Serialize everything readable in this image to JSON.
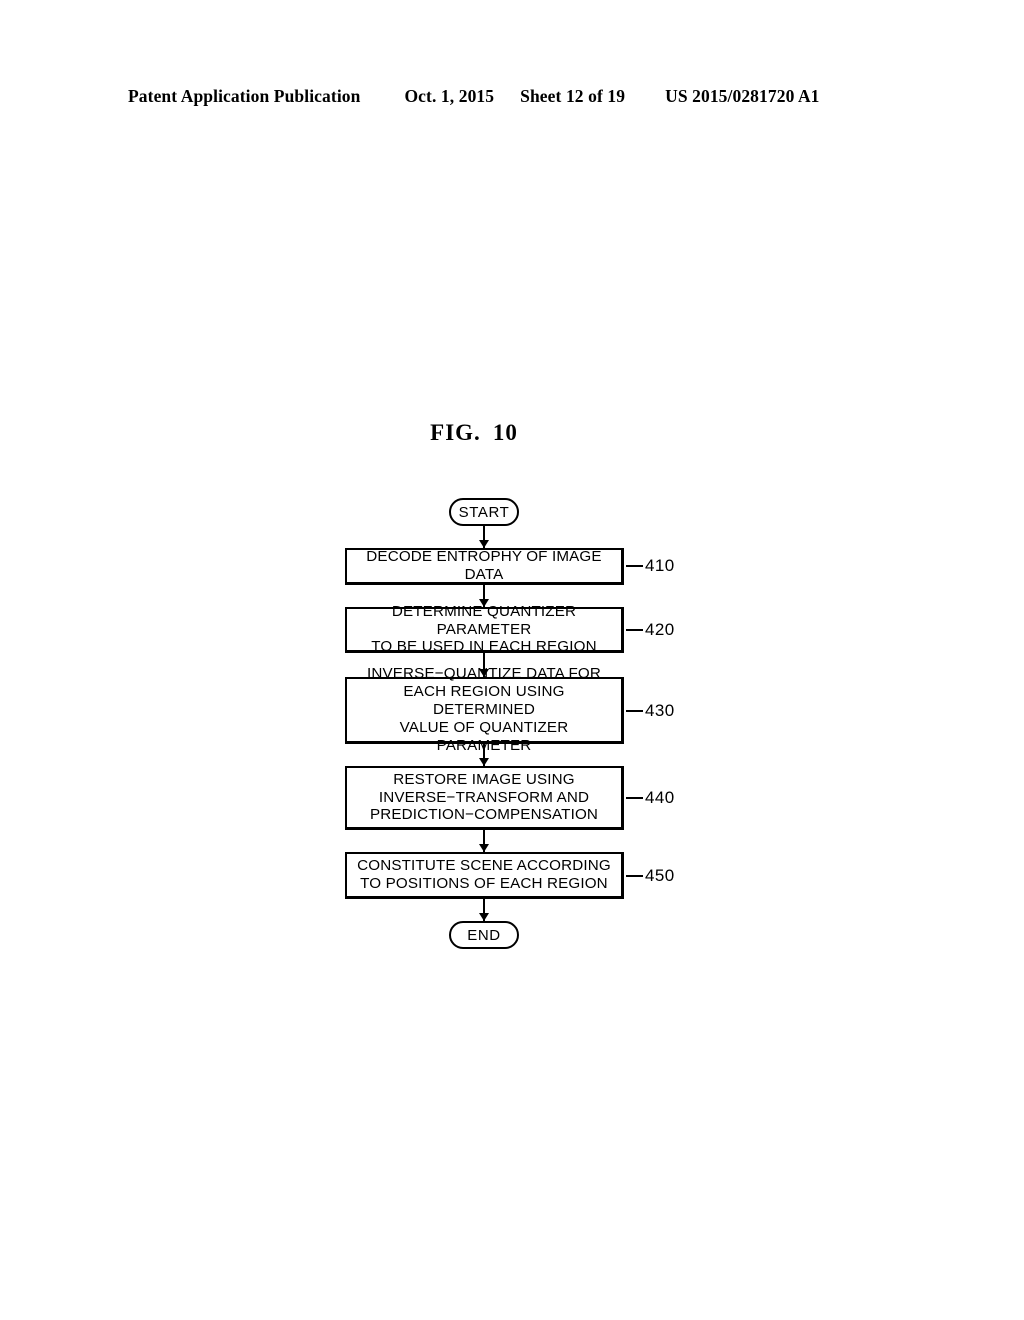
{
  "header": {
    "publication": "Patent Application Publication",
    "date": "Oct. 1, 2015",
    "sheet": "Sheet 12 of 19",
    "patent_number": "US 2015/0281720 A1"
  },
  "figure": {
    "label": "FIG.",
    "number": "10"
  },
  "flowchart": {
    "start_label": "START",
    "end_label": "END",
    "steps": [
      {
        "ref": "410",
        "text": "DECODE ENTROPHY OF IMAGE DATA",
        "lines": 1
      },
      {
        "ref": "420",
        "text": "DETERMINE QUANTIZER PARAMETER\nTO BE USED IN EACH REGION",
        "lines": 2
      },
      {
        "ref": "430",
        "text": "INVERSE−QUANTIZE DATA FOR\nEACH REGION USING DETERMINED\nVALUE OF QUANTIZER PARAMETER",
        "lines": 3
      },
      {
        "ref": "440",
        "text": "RESTORE IMAGE USING\nINVERSE−TRANSFORM AND\nPREDICTION−COMPENSATION",
        "lines": 3
      },
      {
        "ref": "450",
        "text": "CONSTITUTE SCENE ACCORDING\nTO POSITIONS OF EACH REGION",
        "lines": 2
      }
    ]
  },
  "colors": {
    "ink": "#000000",
    "paper": "#ffffff"
  }
}
